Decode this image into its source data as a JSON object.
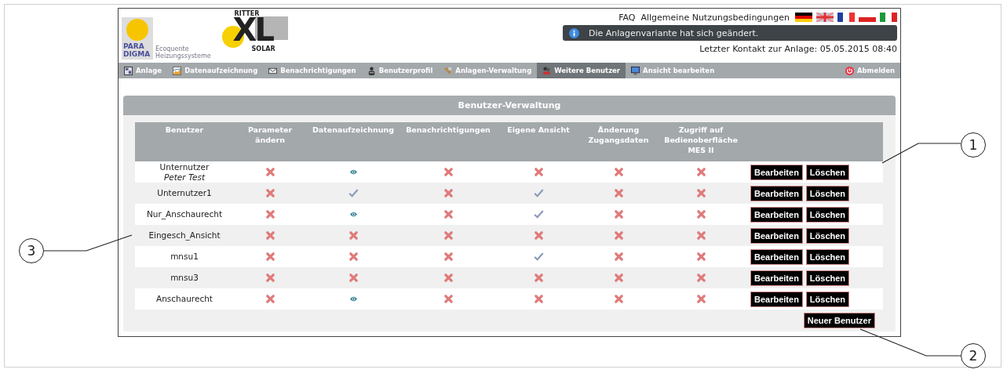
{
  "header": {
    "brand_left": {
      "line1": "PARA",
      "line2": "DIGMA",
      "tagline1": "Ecoquente",
      "tagline2": "Heizungssysteme"
    },
    "brand_right": {
      "top": "RITTER",
      "big": "XL",
      "bottom": "SOLAR"
    },
    "links": [
      "FAQ",
      "Allgemeine Nutzungsbedingungen"
    ],
    "languages": [
      {
        "kind": "de"
      },
      {
        "kind": "gb"
      },
      {
        "kind": "fr"
      },
      {
        "kind": "pl"
      },
      {
        "kind": "it"
      }
    ],
    "notice": "Die Anlagenvariante hat sich geändert.",
    "last_contact": "Letzter Kontakt zur Anlage: 05.05.2015 08:40"
  },
  "nav": [
    {
      "label": "Anlage",
      "kind": "plant",
      "selected": false
    },
    {
      "label": "Datenaufzeichnung",
      "kind": "chart",
      "selected": false
    },
    {
      "label": "Benachrichtigungen",
      "kind": "mail",
      "selected": false
    },
    {
      "label": "Benutzerprofil",
      "kind": "person",
      "selected": false
    },
    {
      "label": "Anlagen-Verwaltung",
      "kind": "tools",
      "selected": false
    },
    {
      "label": "Weitere Benutzer",
      "kind": "users",
      "selected": true
    },
    {
      "label": "Ansicht bearbeiten",
      "kind": "monitor",
      "selected": false
    }
  ],
  "logout": "Abmelden",
  "panel": {
    "title": "Benutzer-Verwaltung",
    "columns": [
      "Benutzer",
      "Parameter ändern",
      "Datenaufzeichnung",
      "Benachrichtigungen",
      "Eigene Ansicht",
      "Änderung Zugangsdaten",
      "Zugriff auf Bedienoberfläche MES II"
    ],
    "rows": [
      {
        "user": "Unternutzer",
        "subtitle": "Peter Test",
        "rights": [
          {
            "kind": "none"
          },
          {
            "kind": "view"
          },
          {
            "kind": "none"
          },
          {
            "kind": "none"
          },
          {
            "kind": "none"
          },
          {
            "kind": "none"
          }
        ],
        "edit": "Bearbeiten",
        "delete": "Löschen"
      },
      {
        "user": "Unternutzer1",
        "rights": [
          {
            "kind": "none"
          },
          {
            "kind": "full"
          },
          {
            "kind": "none"
          },
          {
            "kind": "full"
          },
          {
            "kind": "none"
          },
          {
            "kind": "none"
          }
        ],
        "edit": "Bearbeiten",
        "delete": "Löschen"
      },
      {
        "user": "Nur_Anschaurecht",
        "rights": [
          {
            "kind": "none"
          },
          {
            "kind": "view"
          },
          {
            "kind": "none"
          },
          {
            "kind": "full"
          },
          {
            "kind": "none"
          },
          {
            "kind": "none"
          }
        ],
        "edit": "Bearbeiten",
        "delete": "Löschen"
      },
      {
        "user": "Eingesch_Ansicht",
        "rights": [
          {
            "kind": "none"
          },
          {
            "kind": "none"
          },
          {
            "kind": "none"
          },
          {
            "kind": "none"
          },
          {
            "kind": "none"
          },
          {
            "kind": "none"
          }
        ],
        "edit": "Bearbeiten",
        "delete": "Löschen"
      },
      {
        "user": "mnsu1",
        "rights": [
          {
            "kind": "none"
          },
          {
            "kind": "none"
          },
          {
            "kind": "none"
          },
          {
            "kind": "full"
          },
          {
            "kind": "none"
          },
          {
            "kind": "none"
          }
        ],
        "edit": "Bearbeiten",
        "delete": "Löschen"
      },
      {
        "user": "mnsu3",
        "rights": [
          {
            "kind": "none"
          },
          {
            "kind": "none"
          },
          {
            "kind": "none"
          },
          {
            "kind": "none"
          },
          {
            "kind": "none"
          },
          {
            "kind": "none"
          }
        ],
        "edit": "Bearbeiten",
        "delete": "Löschen"
      },
      {
        "user": "Anschaurecht",
        "rights": [
          {
            "kind": "none"
          },
          {
            "kind": "view"
          },
          {
            "kind": "none"
          },
          {
            "kind": "none"
          },
          {
            "kind": "none"
          },
          {
            "kind": "none"
          }
        ],
        "edit": "Bearbeiten",
        "delete": "Löschen"
      }
    ],
    "new_user": "Neuer Benutzer"
  },
  "callouts": [
    "1",
    "2",
    "3"
  ]
}
